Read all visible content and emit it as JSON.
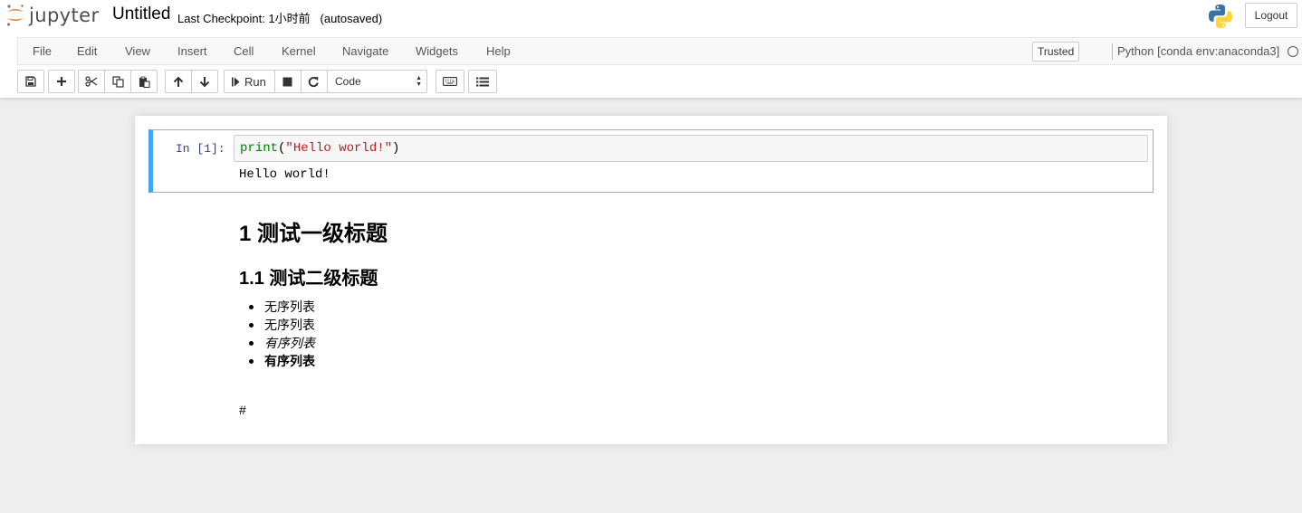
{
  "header": {
    "logo_text": "jupyter",
    "notebook_title": "Untitled",
    "checkpoint_text": "Last Checkpoint: 1小时前   (autosaved)",
    "logout_label": "Logout",
    "logo_colors": {
      "jupyter_orange": "#F37726",
      "python_blue": "#3A72A4",
      "python_yellow": "#FFD43B"
    }
  },
  "menubar": {
    "items": [
      "File",
      "Edit",
      "View",
      "Insert",
      "Cell",
      "Kernel",
      "Navigate",
      "Widgets",
      "Help"
    ],
    "trusted_label": "Trusted",
    "kernel_name": "Python [conda env:anaconda3]",
    "kernel_status": "idle"
  },
  "toolbar": {
    "icons": [
      "save-icon",
      "plus-icon",
      "cut-icon",
      "copy-icon",
      "paste-icon",
      "arrow-up-icon",
      "arrow-down-icon",
      "step-forward-icon",
      "stop-icon",
      "refresh-icon",
      "keyboard-icon",
      "list-icon"
    ],
    "run_label": "Run",
    "cell_type_selected": "Code"
  },
  "notebook": {
    "code_cell": {
      "prompt": "In [1]:",
      "code": {
        "builtin": "print",
        "open_paren": "(",
        "string": "\"Hello world!\"",
        "close_paren": ")"
      },
      "output": "Hello world!",
      "selected_color": "#42A5F5"
    },
    "markdown": {
      "h1": "1  测试一级标题",
      "h2": "1.1  测试二级标题",
      "list_items": [
        {
          "text": "无序列表",
          "style": "normal"
        },
        {
          "text": "无序列表",
          "style": "normal"
        },
        {
          "text": "有序列表",
          "style": "italic"
        },
        {
          "text": "有序列表",
          "style": "bold"
        }
      ],
      "trailing_text": "#"
    }
  }
}
